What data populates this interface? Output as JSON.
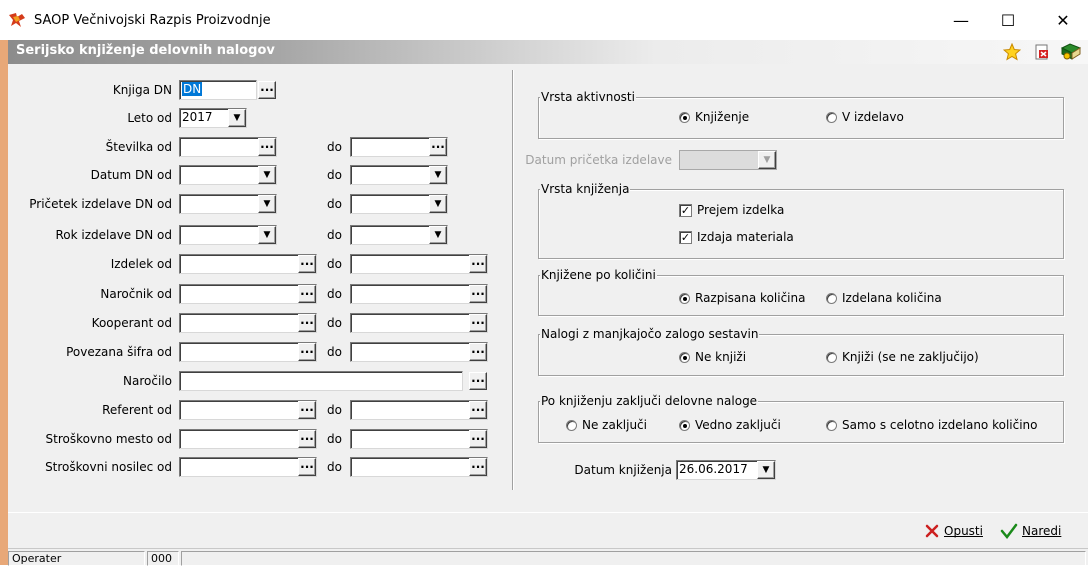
{
  "window": {
    "title": "SAOP  Večnivojski Razpis Proizvodnje",
    "minimize": "—",
    "maximize": "☐",
    "close": "✕"
  },
  "caption": {
    "title": "Serijsko knjiženje delovnih nalogov"
  },
  "left": {
    "knjiga_label": "Knjiga DN",
    "knjiga_value": "DN",
    "leto_label": "Leto od",
    "leto_value": "2017",
    "do": "do",
    "rows": [
      {
        "label": "Številka od"
      },
      {
        "label": "Datum DN od"
      },
      {
        "label": "Pričetek izdelave DN od"
      },
      {
        "label": "Rok izdelave DN od"
      },
      {
        "label": "Izdelek od"
      },
      {
        "label": "Naročnik od"
      },
      {
        "label": "Kooperant od"
      },
      {
        "label": "Povezana šifra od"
      },
      {
        "label": "Naročilo"
      },
      {
        "label": "Referent od"
      },
      {
        "label": "Stroškovno mesto od"
      },
      {
        "label": "Stroškovni nosilec od"
      }
    ]
  },
  "right": {
    "vrsta_aktivnosti": {
      "title": "Vrsta aktivnosti",
      "opt1": "Knjiženje",
      "opt2": "V izdelavo",
      "selected": "Knjiženje"
    },
    "datum_pricetka": {
      "label": "Datum pričetka izdelave",
      "value": ""
    },
    "vrsta_knjizenja": {
      "title": "Vrsta knjiženja",
      "chk1": "Prejem izdelka",
      "chk2": "Izdaja materiala",
      "chk1_checked": true,
      "chk2_checked": true
    },
    "po_kolicini": {
      "title": "Knjižene po količini",
      "opt1": "Razpisana količina",
      "opt2": "Izdelana količina",
      "selected": "Razpisana količina"
    },
    "manjkajoca": {
      "title": "Nalogi z manjkajočo zalogo sestavin",
      "opt1": "Ne knjiži",
      "opt2": "Knjiži (se ne zaključijo)",
      "selected": "Ne knjiži"
    },
    "zakljuci": {
      "title": "Po knjiženju zaključi delovne naloge",
      "opt1": "Ne zaključi",
      "opt2": "Vedno zaključi",
      "opt3": "Samo s celotno izdelano količino",
      "selected": "Vedno zaključi"
    },
    "datum_knjizenja": {
      "label": "Datum knjiženja",
      "value": "26.06.2017"
    }
  },
  "actions": {
    "cancel": "Opusti",
    "ok": "Naredi"
  },
  "status": {
    "operater_label": "Operater",
    "operater_value": "000"
  },
  "colors": {
    "accent": "#0078d7",
    "cancel": "#cc1f1f",
    "ok": "#1a8a1a"
  }
}
